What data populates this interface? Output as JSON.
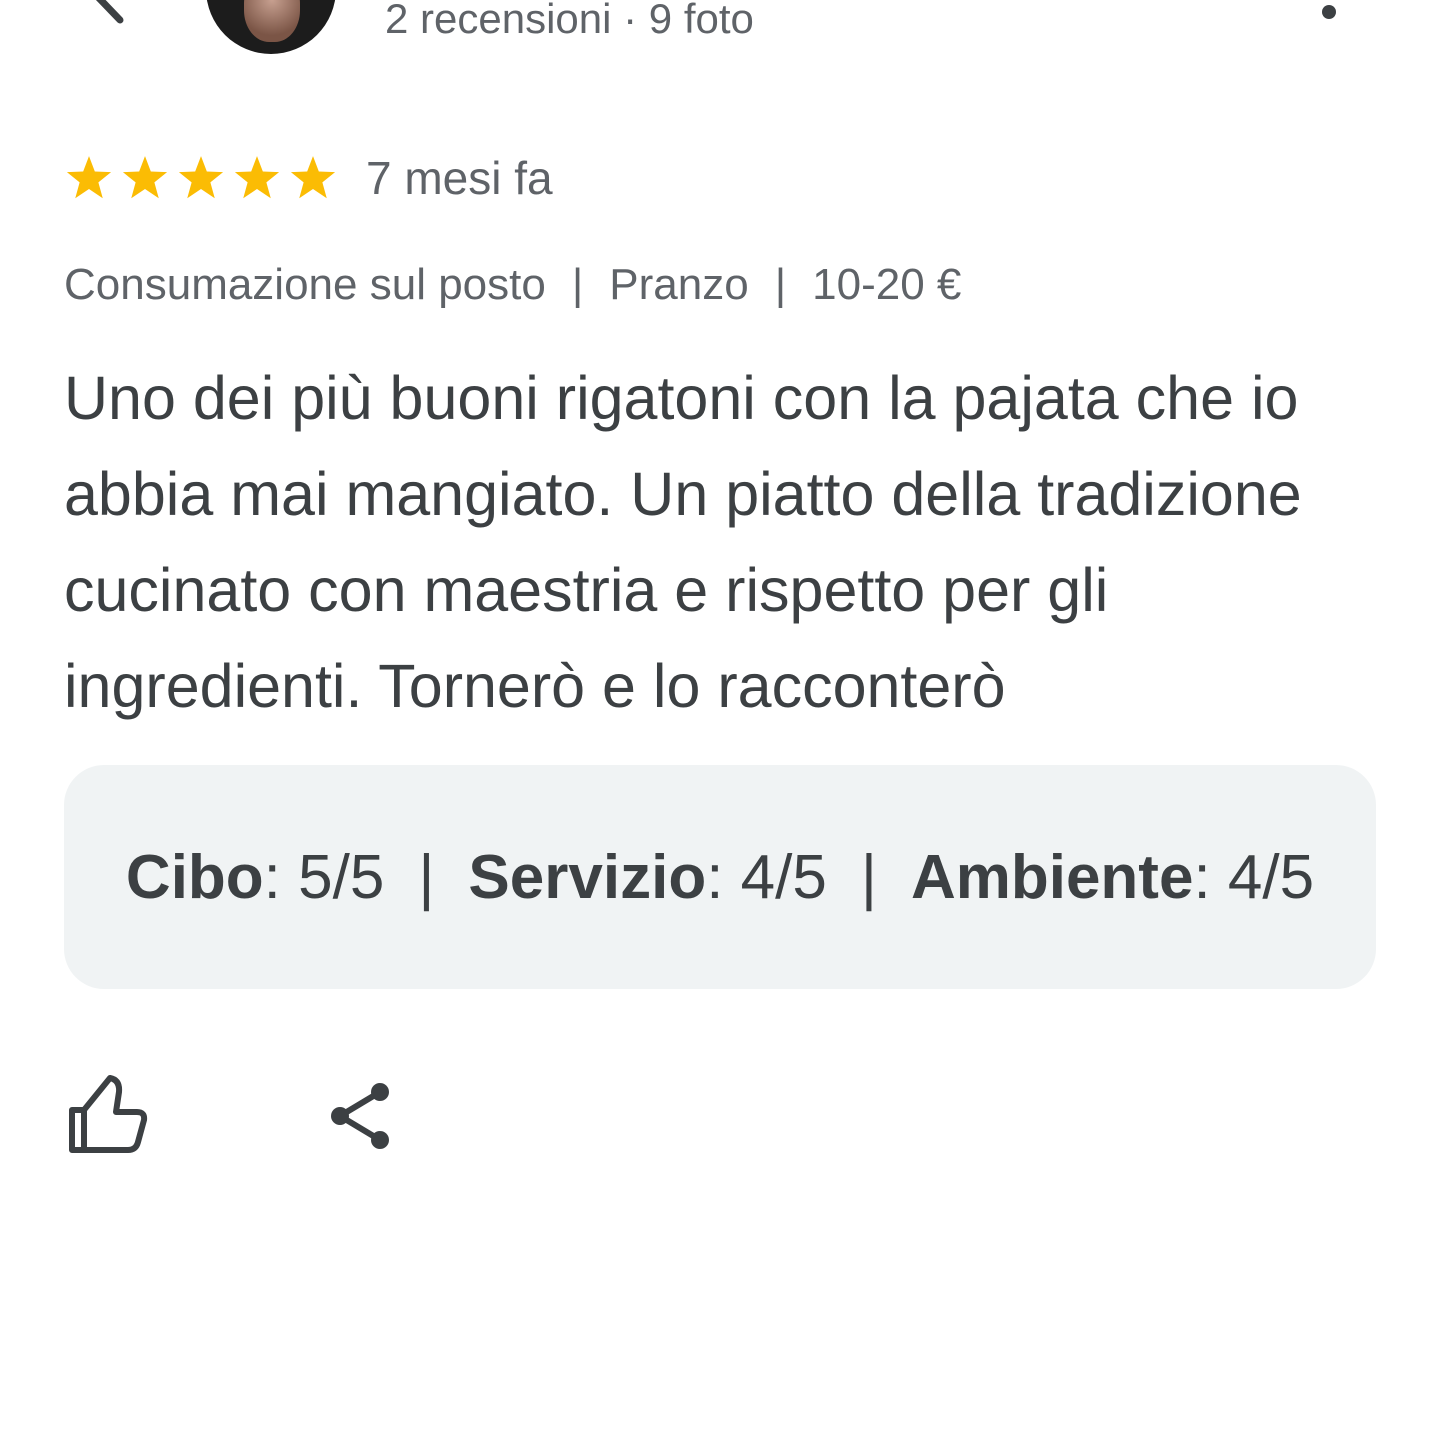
{
  "header": {
    "back_icon": "chevron-left-icon",
    "author_meta": "2 recensioni · 9 foto",
    "more_icon": "more-vert-icon"
  },
  "rating": {
    "stars_value": 5,
    "stars_max": 5,
    "star_color": "#fbbc04",
    "time_ago": "7 mesi fa"
  },
  "dining": {
    "service": "Consumazione sul posto",
    "meal": "Pranzo",
    "price": "10-20 €",
    "separator": "|"
  },
  "review": {
    "text": "Uno dei più buoni rigatoni con la pajata che io abbia mai mangiato. Un piatto della tradizione cucinato con maestria e rispetto per gli ingredienti. Tornerò e lo racconterò"
  },
  "sub_ratings": {
    "separator": "|",
    "items": [
      {
        "label": "Cibo",
        "value": ": 5/5"
      },
      {
        "label": "Servizio",
        "value": ": 4/5"
      },
      {
        "label": "Ambiente",
        "value": ": 4/5"
      }
    ]
  },
  "actions": {
    "like_icon": "thumb-up-icon",
    "share_icon": "share-icon"
  },
  "colors": {
    "text_primary": "#3c4043",
    "text_secondary": "#5f6368",
    "card_background": "#f0f3f4"
  }
}
